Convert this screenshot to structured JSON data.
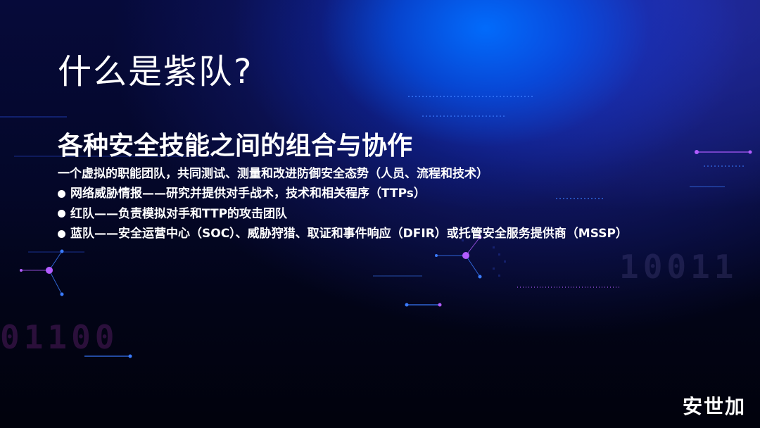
{
  "slide": {
    "title": "什么是紫队?",
    "subtitle": "各种安全技能之间的组合与协作",
    "intro": "一个虚拟的职能团队，共同测试、测量和改进防御安全态势（人员、流程和技术）",
    "bullets": [
      "网络威胁情报——研究并提供对手战术，技术和相关程序（TTPs）",
      "红队——负责模拟对手和TTP的攻击团队",
      "蓝队——安全运营中心（SOC）、威胁狩猎、取证和事件响应（DFIR）或托管安全服务提供商（MSSP）"
    ],
    "logo": "安世加",
    "background_digits": [
      "10011",
      "01100"
    ]
  },
  "colors": {
    "accent_blue": "#0a6cff",
    "accent_purple": "#b25cff",
    "text": "#ffffff"
  }
}
